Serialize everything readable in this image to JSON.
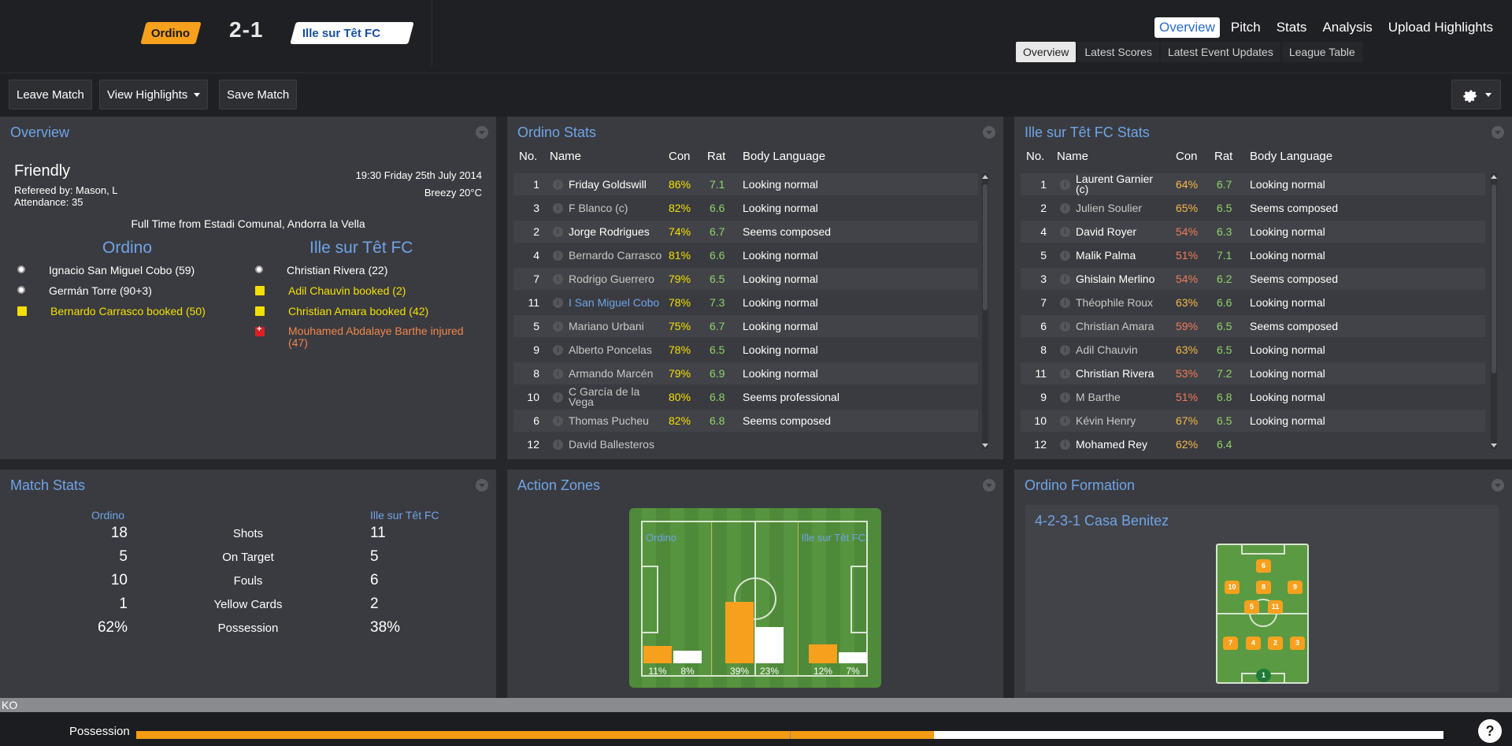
{
  "header": {
    "home_team": "Ordino",
    "score": "2-1",
    "away_team": "Ille sur Têt FC",
    "nav": [
      "Overview",
      "Pitch",
      "Stats",
      "Analysis",
      "Upload Highlights"
    ],
    "subnav": [
      "Overview",
      "Latest Scores",
      "Latest Event Updates",
      "League Table"
    ]
  },
  "toolbar": {
    "leave": "Leave Match",
    "highlights": "View Highlights",
    "save": "Save Match"
  },
  "overview": {
    "title": "Overview",
    "competition": "Friendly",
    "referee": "Refereed by: Mason, L",
    "attendance": "Attendance: 35",
    "datetime": "19:30 Friday 25th July 2014",
    "weather": "Breezy 20°C",
    "fulltime": "Full Time from Estadi Comunal, Andorra la Vella",
    "home_name": "Ordino",
    "away_name": "Ille sur Têt FC",
    "home_events": [
      {
        "type": "goal",
        "text": "Ignacio San Miguel Cobo (59)"
      },
      {
        "type": "goal",
        "text": "Germán Torre (90+3)"
      },
      {
        "type": "yellow",
        "text": "Bernardo Carrasco booked (50)"
      }
    ],
    "away_events": [
      {
        "type": "goal",
        "text": "Christian Rivera (22)"
      },
      {
        "type": "yellow",
        "text": "Adil Chauvin booked (2)"
      },
      {
        "type": "yellow",
        "text": "Christian Amara booked (42)"
      },
      {
        "type": "injury",
        "text": "Mouhamed Abdalaye Barthe injured (47)"
      }
    ]
  },
  "ordino_stats": {
    "title": "Ordino Stats",
    "headers": {
      "no": "No.",
      "name": "Name",
      "con": "Con",
      "rat": "Rat",
      "body": "Body Language"
    },
    "rows": [
      {
        "no": "1",
        "name": "Friday Goldswill",
        "con": "86%",
        "rat": "7.1",
        "body": "Looking normal",
        "style": "bold"
      },
      {
        "no": "3",
        "name": "F Blanco (c)",
        "con": "82%",
        "rat": "6.6",
        "body": "Looking normal",
        "style": "dim"
      },
      {
        "no": "2",
        "name": "Jorge Rodrigues",
        "con": "74%",
        "rat": "6.7",
        "body": "Seems composed",
        "style": "bold"
      },
      {
        "no": "4",
        "name": "Bernardo Carrasco",
        "con": "81%",
        "rat": "6.6",
        "body": "Looking normal",
        "style": "dim"
      },
      {
        "no": "7",
        "name": "Rodrigo Guerrero",
        "con": "79%",
        "rat": "6.5",
        "body": "Looking normal",
        "style": "dim"
      },
      {
        "no": "11",
        "name": "I San Miguel Cobo",
        "con": "78%",
        "rat": "7.3",
        "body": "Looking normal",
        "style": "blue"
      },
      {
        "no": "5",
        "name": "Mariano Urbani",
        "con": "75%",
        "rat": "6.7",
        "body": "Looking normal",
        "style": "dim"
      },
      {
        "no": "9",
        "name": "Alberto Poncelas",
        "con": "78%",
        "rat": "6.5",
        "body": "Looking normal",
        "style": "dim"
      },
      {
        "no": "8",
        "name": "Armando Marcén",
        "con": "79%",
        "rat": "6.9",
        "body": "Looking normal",
        "style": "dim"
      },
      {
        "no": "10",
        "name": "C García de la Vega",
        "con": "80%",
        "rat": "6.8",
        "body": "Seems professional",
        "style": "dim"
      },
      {
        "no": "6",
        "name": "Thomas Pucheu",
        "con": "82%",
        "rat": "6.8",
        "body": "Seems composed",
        "style": "dim"
      },
      {
        "no": "12",
        "name": "David Ballesteros",
        "con": "",
        "rat": "",
        "body": "",
        "style": "dim"
      }
    ]
  },
  "away_stats": {
    "title": "Ille sur Têt FC Stats",
    "headers": {
      "no": "No.",
      "name": "Name",
      "con": "Con",
      "rat": "Rat",
      "body": "Body Language"
    },
    "rows": [
      {
        "no": "1",
        "name": "Laurent Garnier (c)",
        "con": "64%",
        "rat": "6.7",
        "body": "Looking normal",
        "style": "bold"
      },
      {
        "no": "2",
        "name": "Julien Soulier",
        "con": "65%",
        "rat": "6.5",
        "body": "Seems composed",
        "style": "dim"
      },
      {
        "no": "4",
        "name": "David Royer",
        "con": "54%",
        "rat": "6.3",
        "body": "Looking normal",
        "style": "bold"
      },
      {
        "no": "5",
        "name": "Malik Palma",
        "con": "51%",
        "rat": "7.1",
        "body": "Looking normal",
        "style": "bold"
      },
      {
        "no": "3",
        "name": "Ghislain Merlino",
        "con": "54%",
        "rat": "6.2",
        "body": "Seems composed",
        "style": "bold"
      },
      {
        "no": "7",
        "name": "Théophile Roux",
        "con": "63%",
        "rat": "6.6",
        "body": "Looking normal",
        "style": "dim"
      },
      {
        "no": "6",
        "name": "Christian Amara",
        "con": "59%",
        "rat": "6.5",
        "body": "Seems composed",
        "style": "dim"
      },
      {
        "no": "8",
        "name": "Adil Chauvin",
        "con": "63%",
        "rat": "6.5",
        "body": "Looking normal",
        "style": "dim"
      },
      {
        "no": "11",
        "name": "Christian Rivera",
        "con": "53%",
        "rat": "7.2",
        "body": "Looking normal",
        "style": "bold"
      },
      {
        "no": "9",
        "name": "M Barthe",
        "con": "51%",
        "rat": "6.8",
        "body": "Looking normal",
        "style": "dim"
      },
      {
        "no": "10",
        "name": "Kévin Henry",
        "con": "67%",
        "rat": "6.5",
        "body": "Looking normal",
        "style": "dim"
      },
      {
        "no": "12",
        "name": "Mohamed Rey",
        "con": "62%",
        "rat": "6.4",
        "body": "",
        "style": "bold"
      }
    ]
  },
  "match_stats": {
    "title": "Match Stats",
    "home": "Ordino",
    "away": "Ille sur Têt FC",
    "rows": [
      {
        "label": "Shots",
        "home": "18",
        "away": "11"
      },
      {
        "label": "On Target",
        "home": "5",
        "away": "5"
      },
      {
        "label": "Fouls",
        "home": "10",
        "away": "6"
      },
      {
        "label": "Yellow Cards",
        "home": "1",
        "away": "2"
      },
      {
        "label": "Possession",
        "home": "62%",
        "away": "38%"
      }
    ]
  },
  "action_zones": {
    "title": "Action Zones",
    "home_label": "Ordino",
    "away_label": "Ille sur Têt FC",
    "zones": [
      {
        "home": 11,
        "away": 8,
        "home_label": "11%",
        "away_label": "8%"
      },
      {
        "home": 39,
        "away": 23,
        "home_label": "39%",
        "away_label": "23%"
      },
      {
        "home": 12,
        "away": 7,
        "home_label": "12%",
        "away_label": "7%"
      }
    ]
  },
  "formation": {
    "title": "Ordino Formation",
    "name": "4-2-3-1 Casa Benitez",
    "shirts": [
      "6",
      "10",
      "8",
      "9",
      "5",
      "11",
      "7",
      "4",
      "2",
      "3",
      "1"
    ]
  },
  "bottom": {
    "ko": "KO",
    "possession_label": "Possession",
    "possession_home": 0.61,
    "help": "?"
  },
  "colors": {
    "home": "#f7a01d",
    "away": "#ffffff",
    "accent": "#6fa4e6"
  }
}
